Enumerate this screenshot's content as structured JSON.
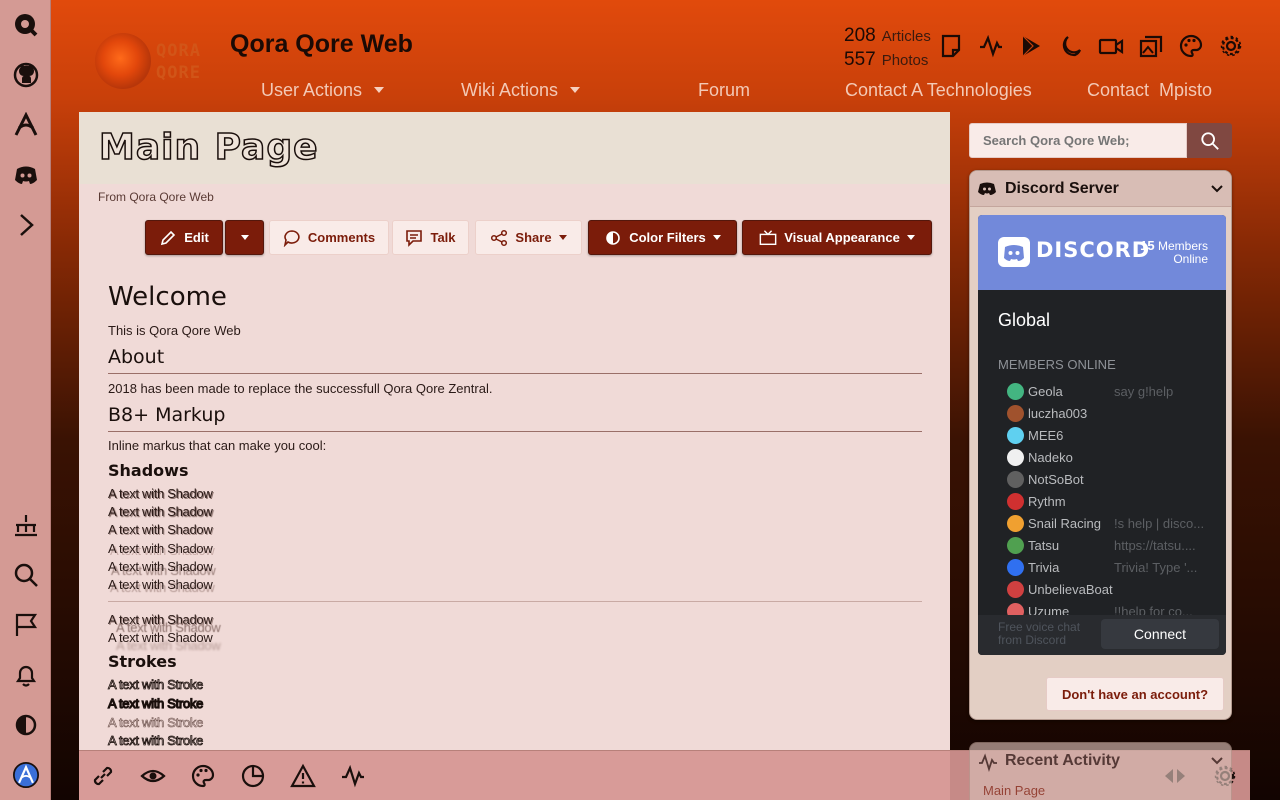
{
  "site": {
    "title": "Qora Qore Web",
    "logo_text": "QORA QORE"
  },
  "nav": [
    {
      "label": "User Actions",
      "dropdown": true
    },
    {
      "label": "Wiki Actions",
      "dropdown": true
    },
    {
      "label": "Forum",
      "dropdown": false
    },
    {
      "label": "Contact A Technologies",
      "dropdown": false
    },
    {
      "label": "Contact  Mpisto",
      "dropdown": false
    }
  ],
  "stats": {
    "articles_count": "208",
    "articles_label": "Articles",
    "photos_count": "557",
    "photos_label": "Photos"
  },
  "header_icons": [
    "page-icon",
    "activity-icon",
    "play-store-icon",
    "moon-icon",
    "video-icon",
    "gallery-icon",
    "palette-icon",
    "gear-icon"
  ],
  "left_rail": {
    "top": [
      "qora-icon",
      "github-icon",
      "arc-icon",
      "discord-icon",
      "chevron-right-icon"
    ],
    "bottom": [
      "sitemap-icon",
      "search-icon",
      "flag-icon",
      "bell-icon",
      "contrast-icon",
      "avatar-icon"
    ]
  },
  "page": {
    "title": "Main Page",
    "from": "From Qora Qore Web"
  },
  "toolbar": {
    "edit": "Edit",
    "comments": "Comments",
    "talk": "Talk",
    "share": "Share",
    "color_filters": "Color Filters",
    "visual_appearance": "Visual Appearance"
  },
  "article": {
    "welcome_heading": "Welcome",
    "welcome_text": "This is Qora Qore Web",
    "about_heading": "About",
    "about_text": "2018 has been made to replace the successfull Qora Qore Zentral.",
    "markup_heading": "B8+ Markup",
    "markup_text": "Inline markus that can make you cool:",
    "shadows_heading": "Shadows",
    "shadow_line": "A text with Shadow",
    "strokes_heading": "Strokes",
    "stroke_line": "A text with Stroke"
  },
  "bottom_toolbar": [
    "link-icon",
    "eye-icon",
    "palette-icon",
    "chart-icon",
    "warning-icon",
    "activity-icon",
    "arrows-icon",
    "gear-icon"
  ],
  "sidebar": {
    "search_placeholder": "Search Qora Qore Web;",
    "discord": {
      "header": "Discord Server",
      "wordmark": "DISCORD",
      "online_count": "15",
      "online_label_1": "Members",
      "online_label_2": "Online",
      "guild": "Global",
      "members_label": "MEMBERS ONLINE",
      "members": [
        {
          "name": "Geola",
          "status": "say g!help",
          "color": "#43b581"
        },
        {
          "name": "luczha003",
          "status": "",
          "color": "#a0522d"
        },
        {
          "name": "MEE6",
          "status": "",
          "color": "#5fd0f0"
        },
        {
          "name": "Nadeko",
          "status": "",
          "color": "#f0f0f0"
        },
        {
          "name": "NotSoBot",
          "status": "",
          "color": "#606060"
        },
        {
          "name": "Rythm",
          "status": "",
          "color": "#d03030"
        },
        {
          "name": "Snail Racing",
          "status": "!s help | disco...",
          "color": "#f0a030"
        },
        {
          "name": "Tatsu",
          "status": "https://tatsu....",
          "color": "#50a050"
        },
        {
          "name": "Trivia",
          "status": "Trivia! Type '...",
          "color": "#3070f0"
        },
        {
          "name": "UnbelievaBoat",
          "status": "",
          "color": "#d04040"
        },
        {
          "name": "Uzume",
          "status": "!!help for co...",
          "color": "#e06060"
        }
      ],
      "footer_text": "Free voice chat from Discord",
      "connect": "Connect"
    },
    "account_button": "Don't have an account?",
    "recent_activity": {
      "title": "Recent Activity",
      "first_item": "Main Page"
    }
  },
  "colors": {
    "accent": "#7b1c0a",
    "content_bg": "#f0dad7",
    "rail_bg": "#d49a94",
    "discord_blurple": "#7289da"
  }
}
